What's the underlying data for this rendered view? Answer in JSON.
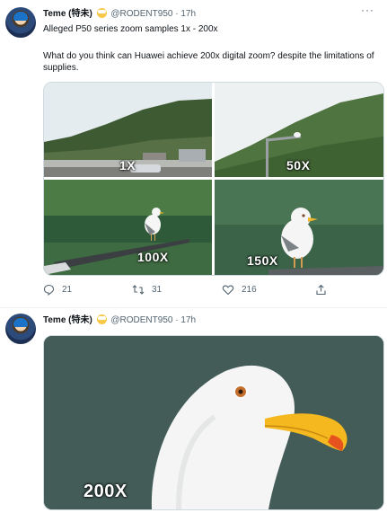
{
  "tweets": [
    {
      "author_name": "Teme (特未)",
      "handle": "@RODENT950",
      "separator": "·",
      "time": "17h",
      "line1": "Alleged P50 series zoom samples 1x - 200x",
      "line2": "What do you think can Huawei achieve 200x digital zoom? despite the limitations of supplies.",
      "media_labels": [
        "1X",
        "50X",
        "100X",
        "150X"
      ],
      "reply_count": "21",
      "retweet_count": "31",
      "like_count": "216"
    },
    {
      "author_name": "Teme (特未)",
      "handle": "@RODENT950",
      "separator": "·",
      "time": "17h",
      "media_label": "200X"
    }
  ],
  "icons": {
    "more": "more-dots-icon",
    "reply": "reply-icon",
    "retweet": "retweet-icon",
    "like": "heart-icon",
    "share": "share-icon"
  },
  "colors": {
    "text": "#0f1419",
    "meta": "#536471",
    "border": "#cfd9de",
    "beak": "#f5b81e"
  }
}
